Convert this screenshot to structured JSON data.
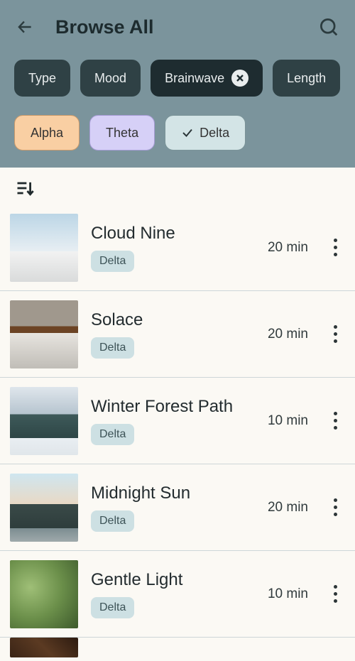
{
  "header": {
    "title": "Browse All"
  },
  "filters": {
    "primary": [
      {
        "label": "Type",
        "active": false
      },
      {
        "label": "Mood",
        "active": false
      },
      {
        "label": "Brainwave",
        "active": true
      },
      {
        "label": "Length",
        "active": false
      }
    ],
    "secondary": [
      {
        "label": "Alpha",
        "style": "alpha",
        "selected": false
      },
      {
        "label": "Theta",
        "style": "theta",
        "selected": false
      },
      {
        "label": "Delta",
        "style": "delta",
        "selected": true
      }
    ]
  },
  "tracks": [
    {
      "title": "Cloud Nine",
      "tag": "Delta",
      "duration": "20 min",
      "thumb": "clouds"
    },
    {
      "title": "Solace",
      "tag": "Delta",
      "duration": "20 min",
      "thumb": "bed"
    },
    {
      "title": "Winter Forest Path",
      "tag": "Delta",
      "duration": "10 min",
      "thumb": "forest"
    },
    {
      "title": "Midnight Sun",
      "tag": "Delta",
      "duration": "20 min",
      "thumb": "sunset"
    },
    {
      "title": "Gentle Light",
      "tag": "Delta",
      "duration": "10 min",
      "thumb": "plant"
    }
  ]
}
